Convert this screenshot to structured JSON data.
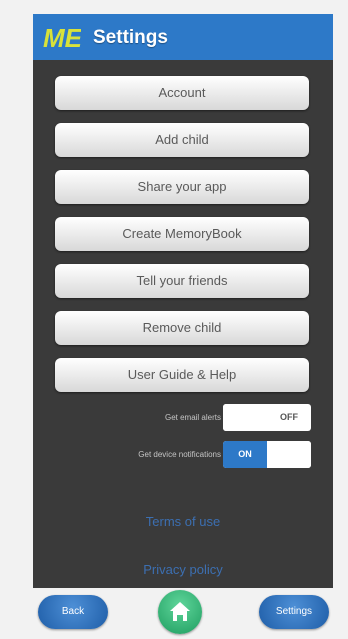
{
  "header": {
    "logo_text": "ME",
    "title": "Settings"
  },
  "menu": {
    "items": [
      {
        "label": "Account"
      },
      {
        "label": "Add child"
      },
      {
        "label": "Share your app"
      },
      {
        "label": "Create MemoryBook"
      },
      {
        "label": "Tell your friends"
      },
      {
        "label": "Remove child"
      },
      {
        "label": "User Guide & Help"
      }
    ]
  },
  "toggles": {
    "email_alerts": {
      "label": "Get email alerts",
      "state": "OFF"
    },
    "device_notifications": {
      "label": "Get device notifications",
      "state": "ON"
    }
  },
  "links": {
    "terms": "Terms of use",
    "privacy": "Privacy policy"
  },
  "bottom_nav": {
    "back": "Back",
    "home_icon": "home-icon",
    "settings": "Settings"
  },
  "colors": {
    "header": "#2d79c8",
    "panel": "#3a3a3a",
    "toggle_on": "#2d79c8",
    "home_button": "#22a366",
    "nav_pill": "#2a6cb8"
  }
}
